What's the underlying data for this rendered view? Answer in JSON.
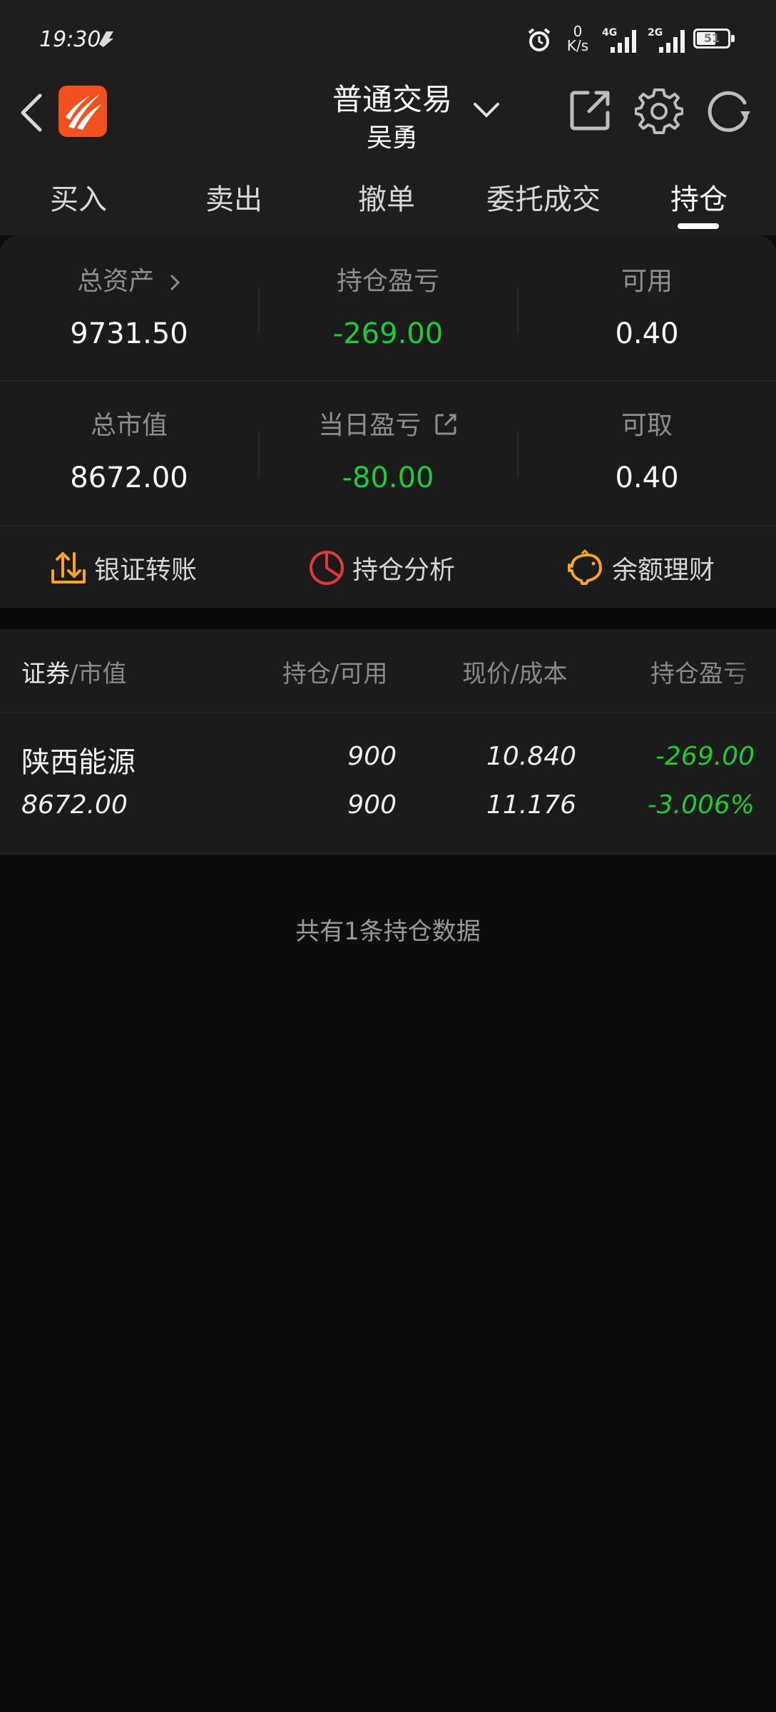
{
  "status_bar": {
    "time": "19:30",
    "net_speed_value": "0",
    "net_speed_unit": "K/s",
    "sim1": "4G",
    "sim2": "2G",
    "battery": "51"
  },
  "header": {
    "title": "普通交易",
    "subtitle": "吴勇"
  },
  "tabs": [
    "买入",
    "卖出",
    "撤单",
    "委托成交",
    "持仓"
  ],
  "active_tab": 4,
  "summary": {
    "total_assets_label": "总资产",
    "total_assets_value": "9731.50",
    "position_pnl_label": "持仓盈亏",
    "position_pnl_value": "-269.00",
    "available_label": "可用",
    "available_value": "0.40",
    "market_value_label": "总市值",
    "market_value_value": "8672.00",
    "daily_pnl_label": "当日盈亏",
    "daily_pnl_value": "-80.00",
    "withdrawable_label": "可取",
    "withdrawable_value": "0.40"
  },
  "actions": {
    "transfer": "银证转账",
    "analysis": "持仓分析",
    "wealth": "余额理财"
  },
  "table": {
    "col1_main": "证券",
    "col1_sub": "/市值",
    "col2": "持仓/可用",
    "col3": "现价/成本",
    "col4": "持仓盈亏",
    "rows": [
      {
        "name": "陕西能源",
        "market_value": "8672.00",
        "position": "900",
        "available": "900",
        "price": "10.840",
        "cost": "11.176",
        "pnl": "-269.00",
        "pnl_pct": "-3.006%"
      }
    ]
  },
  "footer_note": "共有1条持仓数据",
  "colors": {
    "accent_green": "#1ccc3a",
    "logo_orange": "#f0511e",
    "action_orange": "#f5a623",
    "action_red": "#e03a3a"
  }
}
